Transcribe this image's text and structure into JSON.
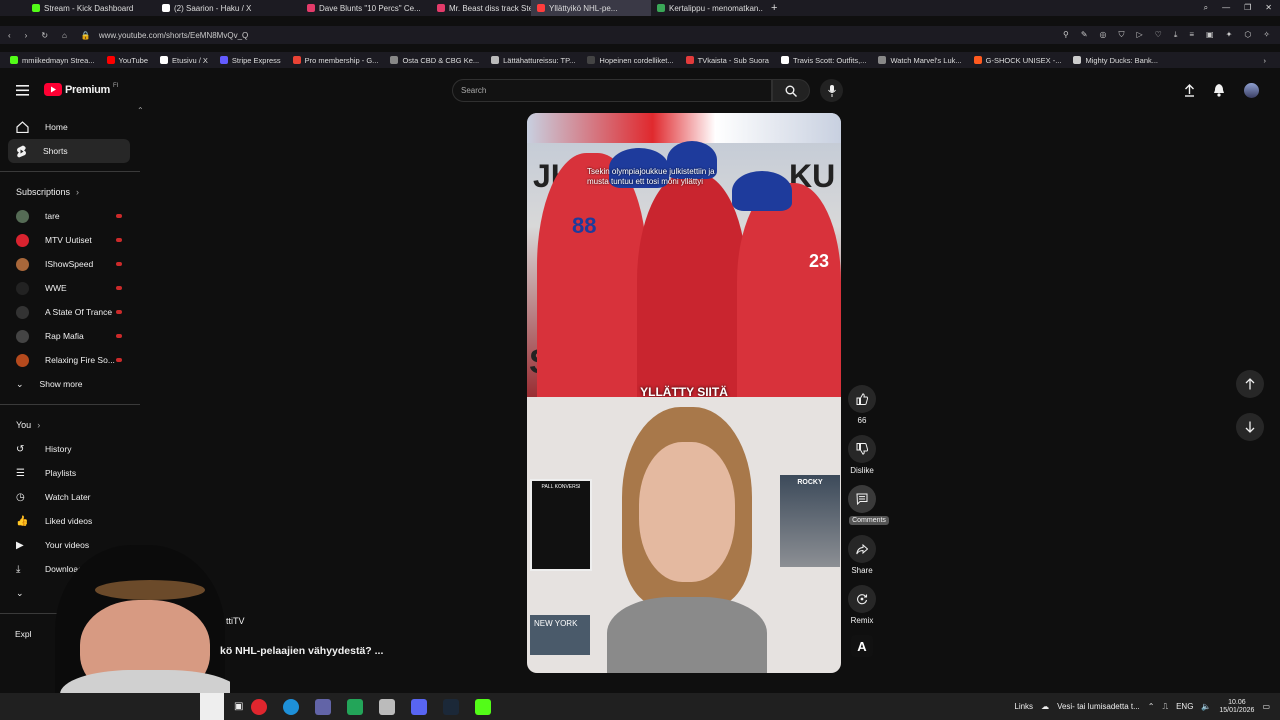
{
  "browser": {
    "tabs": [
      {
        "label": "Stream - Kick Dashboard",
        "color": "#53fc18",
        "active": false
      },
      {
        "label": "(2) Saarion - Haku / X",
        "color": "#ffffff",
        "active": false
      },
      {
        "label": "Dave Blunts \"10 Percs\" Ce...",
        "color": "#e33b6a",
        "active": false
      },
      {
        "label": "Mr. Beast diss track Steve...",
        "color": "#e33b6a",
        "active": false
      },
      {
        "label": "Yllättyikö NHL-pe...",
        "color": "#ff3d3d",
        "active": true
      },
      {
        "label": "Kertalippu - menomatkan...",
        "color": "#3aa757",
        "active": false
      }
    ],
    "url": "www.youtube.com/shorts/EeMN8MvQv_Q",
    "bookmarks": [
      {
        "label": "mmiikedmayn Strea...",
        "color": "#53fc18"
      },
      {
        "label": "YouTube",
        "color": "#ff0000"
      },
      {
        "label": "Etusivu / X",
        "color": "#ffffff"
      },
      {
        "label": "Stripe Express",
        "color": "#635bff"
      },
      {
        "label": "Pro membership - G...",
        "color": "#ea4335"
      },
      {
        "label": "Osta CBD & CBG Ke...",
        "color": "#888888"
      },
      {
        "label": "Lättähattureissu: TP...",
        "color": "#bbbbbb"
      },
      {
        "label": "Hopeinen cordelliket...",
        "color": "#444444"
      },
      {
        "label": "TVkaista - Sub Suora",
        "color": "#e33b3b"
      },
      {
        "label": "Travis Scott: Outfits,...",
        "color": "#ffffff"
      },
      {
        "label": "Watch Marvel's Luk...",
        "color": "#888888"
      },
      {
        "label": "G-SHOCK UNISEX -...",
        "color": "#ff5a1f"
      },
      {
        "label": "Mighty Ducks: Bank...",
        "color": "#cccccc"
      }
    ]
  },
  "header": {
    "logo_text": "Premium",
    "logo_suffix": "FI",
    "search_placeholder": "Search"
  },
  "sidebar": {
    "nav": [
      {
        "label": "Home",
        "icon": "home-icon"
      },
      {
        "label": "Shorts",
        "icon": "shorts-icon",
        "active": true
      }
    ],
    "subscriptions_title": "Subscriptions",
    "subscriptions": [
      {
        "label": "tare",
        "color": "#556b55"
      },
      {
        "label": "MTV Uutiset",
        "color": "#d9232f"
      },
      {
        "label": "IShowSpeed",
        "color": "#a8673a"
      },
      {
        "label": "WWE",
        "color": "#222222"
      },
      {
        "label": "A State Of Trance",
        "color": "#333333"
      },
      {
        "label": "Rap Mafia",
        "color": "#444444"
      },
      {
        "label": "Relaxing Fire So...",
        "color": "#b54a1d"
      }
    ],
    "show_more": "Show more",
    "you_title": "You",
    "you_items": [
      {
        "label": "History"
      },
      {
        "label": "Playlists"
      },
      {
        "label": "Watch Later"
      },
      {
        "label": "Liked videos"
      },
      {
        "label": "Your videos"
      },
      {
        "label": "Downloads"
      }
    ],
    "explore_partial": "Expl"
  },
  "short": {
    "top_caption": "Tsekin olympiajoukkue julkistettiin ja\nmusta tuntuu ett tosi moni yllättyi",
    "mid_caption": "YLLÄTTY SIITÄ",
    "poster_left": "PALL KONVERSI",
    "poster_right": "ROCKY",
    "ny_sign": "NEW YORK",
    "channel_partial": "ttiTV",
    "title_partial": "kö NHL-pelaajien vähyydestä? ..."
  },
  "actions": {
    "like_count": "66",
    "dislike_label": "Dislike",
    "comments_label": "Comments",
    "share_label": "Share",
    "remix_label": "Remix"
  },
  "taskbar": {
    "links_label": "Links",
    "weather": "Vesi- tai lumisadetta t...",
    "lang": "ENG",
    "time": "10.06",
    "date": "15/01/2026"
  }
}
